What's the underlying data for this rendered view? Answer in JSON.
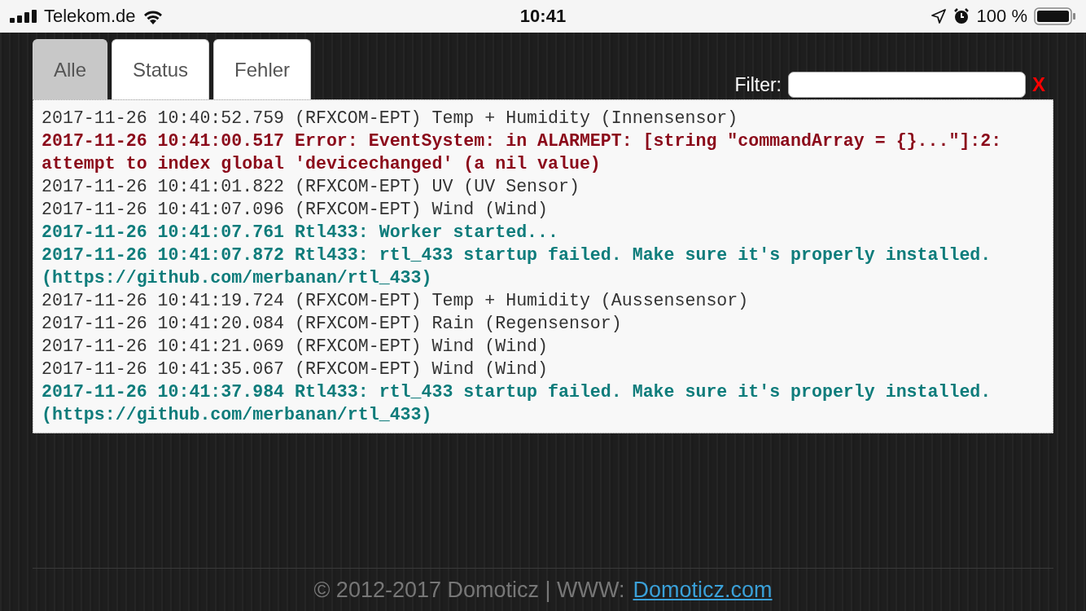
{
  "status_bar": {
    "carrier": "Telekom.de",
    "time": "10:41",
    "battery": "100 %"
  },
  "tabs": [
    {
      "label": "Alle",
      "selected": true
    },
    {
      "label": "Status",
      "selected": false
    },
    {
      "label": "Fehler",
      "selected": false
    }
  ],
  "filter": {
    "label": "Filter:",
    "clear": "X"
  },
  "log": [
    {
      "kind": "normal",
      "text": "2017-11-26 10:40:52.759 (RFXCOM-EPT) Temp + Humidity (Innensensor)"
    },
    {
      "kind": "error",
      "text": "2017-11-26 10:41:00.517 Error: EventSystem: in ALARMEPT: [string \"commandArray = {}...\"]:2: attempt to index global 'devicechanged' (a nil value)"
    },
    {
      "kind": "normal",
      "text": "2017-11-26 10:41:01.822 (RFXCOM-EPT) UV (UV Sensor)"
    },
    {
      "kind": "normal",
      "text": "2017-11-26 10:41:07.096 (RFXCOM-EPT) Wind (Wind)"
    },
    {
      "kind": "status",
      "text": "2017-11-26 10:41:07.761 Rtl433: Worker started..."
    },
    {
      "kind": "status",
      "text": "2017-11-26 10:41:07.872 Rtl433: rtl_433 startup failed. Make sure it's properly installed. (https://github.com/merbanan/rtl_433)"
    },
    {
      "kind": "normal",
      "text": "2017-11-26 10:41:19.724 (RFXCOM-EPT) Temp + Humidity (Aussensensor)"
    },
    {
      "kind": "normal",
      "text": "2017-11-26 10:41:20.084 (RFXCOM-EPT) Rain (Regensensor)"
    },
    {
      "kind": "normal",
      "text": "2017-11-26 10:41:21.069 (RFXCOM-EPT) Wind (Wind)"
    },
    {
      "kind": "normal",
      "text": "2017-11-26 10:41:35.067 (RFXCOM-EPT) Wind (Wind)"
    },
    {
      "kind": "status",
      "text": "2017-11-26 10:41:37.984 Rtl433: rtl_433 startup failed. Make sure it's properly installed. (https://github.com/merbanan/rtl_433)"
    }
  ],
  "footer": {
    "text": "© 2012-2017 Domoticz | WWW:",
    "link": "Domoticz.com"
  }
}
